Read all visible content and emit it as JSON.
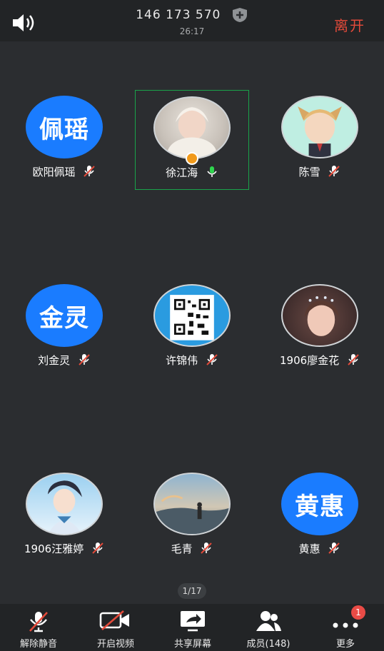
{
  "header": {
    "meeting_id": "146 173 570",
    "timer": "26:17",
    "leave_label": "离开"
  },
  "participants": [
    {
      "name": "欧阳佩瑶",
      "avatar_text": "佩瑶",
      "mic": "muted"
    },
    {
      "name": "徐江海",
      "avatar_text": "",
      "mic": "active",
      "host": true,
      "highlighted": true
    },
    {
      "name": "陈雪",
      "avatar_text": "",
      "mic": "muted"
    },
    {
      "name": "刘金灵",
      "avatar_text": "金灵",
      "mic": "muted"
    },
    {
      "name": "许锦伟",
      "avatar_text": "",
      "mic": "muted"
    },
    {
      "name": "1906廖金花",
      "avatar_text": "",
      "mic": "muted"
    },
    {
      "name": "1906汪雅婷",
      "avatar_text": "",
      "mic": "muted"
    },
    {
      "name": "毛青",
      "avatar_text": "",
      "mic": "muted"
    },
    {
      "name": "黄惠",
      "avatar_text": "黄惠",
      "mic": "muted"
    }
  ],
  "pager": "1/17",
  "toolbar": {
    "unmute": "解除静音",
    "video": "开启视频",
    "share": "共享屏幕",
    "members": "成员(148)",
    "more": "更多",
    "more_badge": "1"
  },
  "colors": {
    "avatar_blue": "#1a7cff",
    "leave_red": "#e34a3a",
    "active_green": "#1aa34a",
    "host_orange": "#f19a1b"
  }
}
